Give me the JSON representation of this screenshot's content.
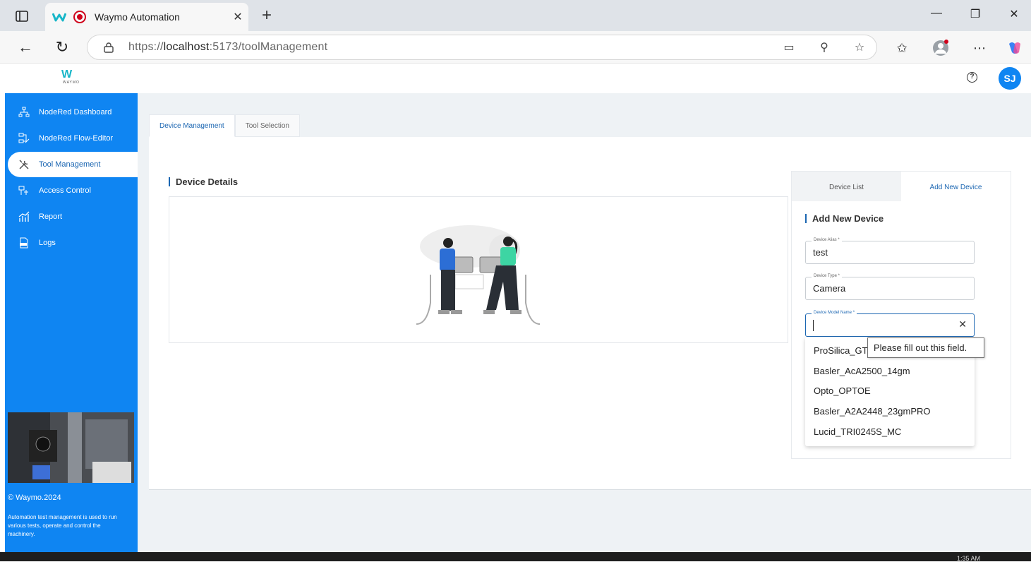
{
  "browser": {
    "tab_title": "Waymo Automation",
    "url_protocol": "https://",
    "url_host": "localhost",
    "url_rest": ":5173/toolManagement"
  },
  "header": {
    "logo_text": "W",
    "logo_sub": "WAYMO",
    "avatar_initials": "SJ",
    "help_glyph": "?"
  },
  "sidebar": {
    "items": [
      {
        "label": "NodeRed Dashboard"
      },
      {
        "label": "NodeRed Flow-Editor"
      },
      {
        "label": "Tool Management"
      },
      {
        "label": "Access Control"
      },
      {
        "label": "Report"
      },
      {
        "label": "Logs"
      }
    ],
    "copyright": "© Waymo.2024",
    "description": "Automation test management is used to run various tests, operate and control the machinery."
  },
  "main": {
    "tabs": [
      {
        "label": "Device Management"
      },
      {
        "label": "Tool Selection"
      }
    ],
    "details_title": "Device Details"
  },
  "right_panel": {
    "tabs": [
      {
        "label": "Device List"
      },
      {
        "label": "Add New Device"
      }
    ],
    "title": "Add New Device",
    "fields": {
      "alias": {
        "label": "Device Alias *",
        "value": "test"
      },
      "type": {
        "label": "Device Type *",
        "value": "Camera"
      },
      "model": {
        "label": "Device Model Name *",
        "value": ""
      }
    },
    "options": [
      "ProSilica_GT",
      "Basler_AcA2500_14gm",
      "Opto_OPTOE",
      "Basler_A2A2448_23gmPRO",
      "Lucid_TRI0245S_MC"
    ],
    "tooltip": "Please fill out this field."
  },
  "taskbar": {
    "time": "1:35 AM"
  },
  "colors": {
    "accent": "#0f85f2",
    "link": "#1b66b2",
    "logo": "#17b6c8"
  }
}
